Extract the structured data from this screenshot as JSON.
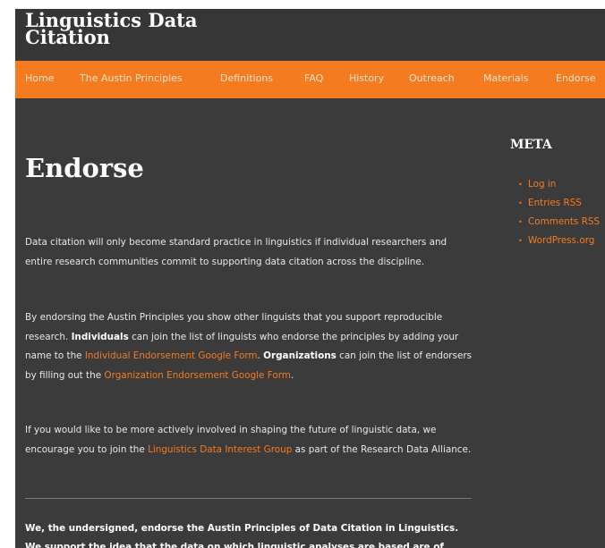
{
  "header": {
    "site_title": "Linguistics Data\nCitation"
  },
  "nav": {
    "items": [
      {
        "label": "Home"
      },
      {
        "label": "The Austin Principles"
      },
      {
        "label": "Definitions"
      },
      {
        "label": "FAQ"
      },
      {
        "label": "History"
      },
      {
        "label": "Outreach"
      },
      {
        "label": "Materials"
      },
      {
        "label": "Endorse"
      }
    ]
  },
  "main": {
    "title": "Endorse",
    "p1": "Data citation will only become standard practice in linguistics if individual researchers and entire research communities commit to supporting data citation across the discipline.",
    "p2": {
      "t1": "By endorsing the Austin Principles you show other linguists that you support reproducible research. ",
      "b1": "Individuals",
      "t2": " can join the list of linguists who endorse the principles by adding your name to the ",
      "link1": "Individual Endorsement Google Form",
      "t3": ". ",
      "b2": "Organizations",
      "t4": " can join the list of endorsers by filling out the ",
      "link2": "Organization Endorsement Google Form",
      "t5": "."
    },
    "p3": {
      "t1": "If you would like to be more actively involved in shaping the future of linguistic data, we encourage you to join the ",
      "link": "Linguistics Data Interest Group",
      "t2": " as part of the Research Data Alliance."
    },
    "p4": "We, the undersigned, endorse the Austin Principles of Data Citation in Linguistics. We support the idea that the data on which linguistic analyses are based are of"
  },
  "sidebar": {
    "heading": "META",
    "bullet": "•",
    "links": [
      {
        "label": "Log in"
      },
      {
        "label": "Entries RSS"
      },
      {
        "label": "Comments RSS"
      },
      {
        "label": "WordPress.org"
      }
    ]
  },
  "colors": {
    "accent": "#f47b20",
    "background": "#3b3b3b",
    "header_bg": "#363636"
  }
}
